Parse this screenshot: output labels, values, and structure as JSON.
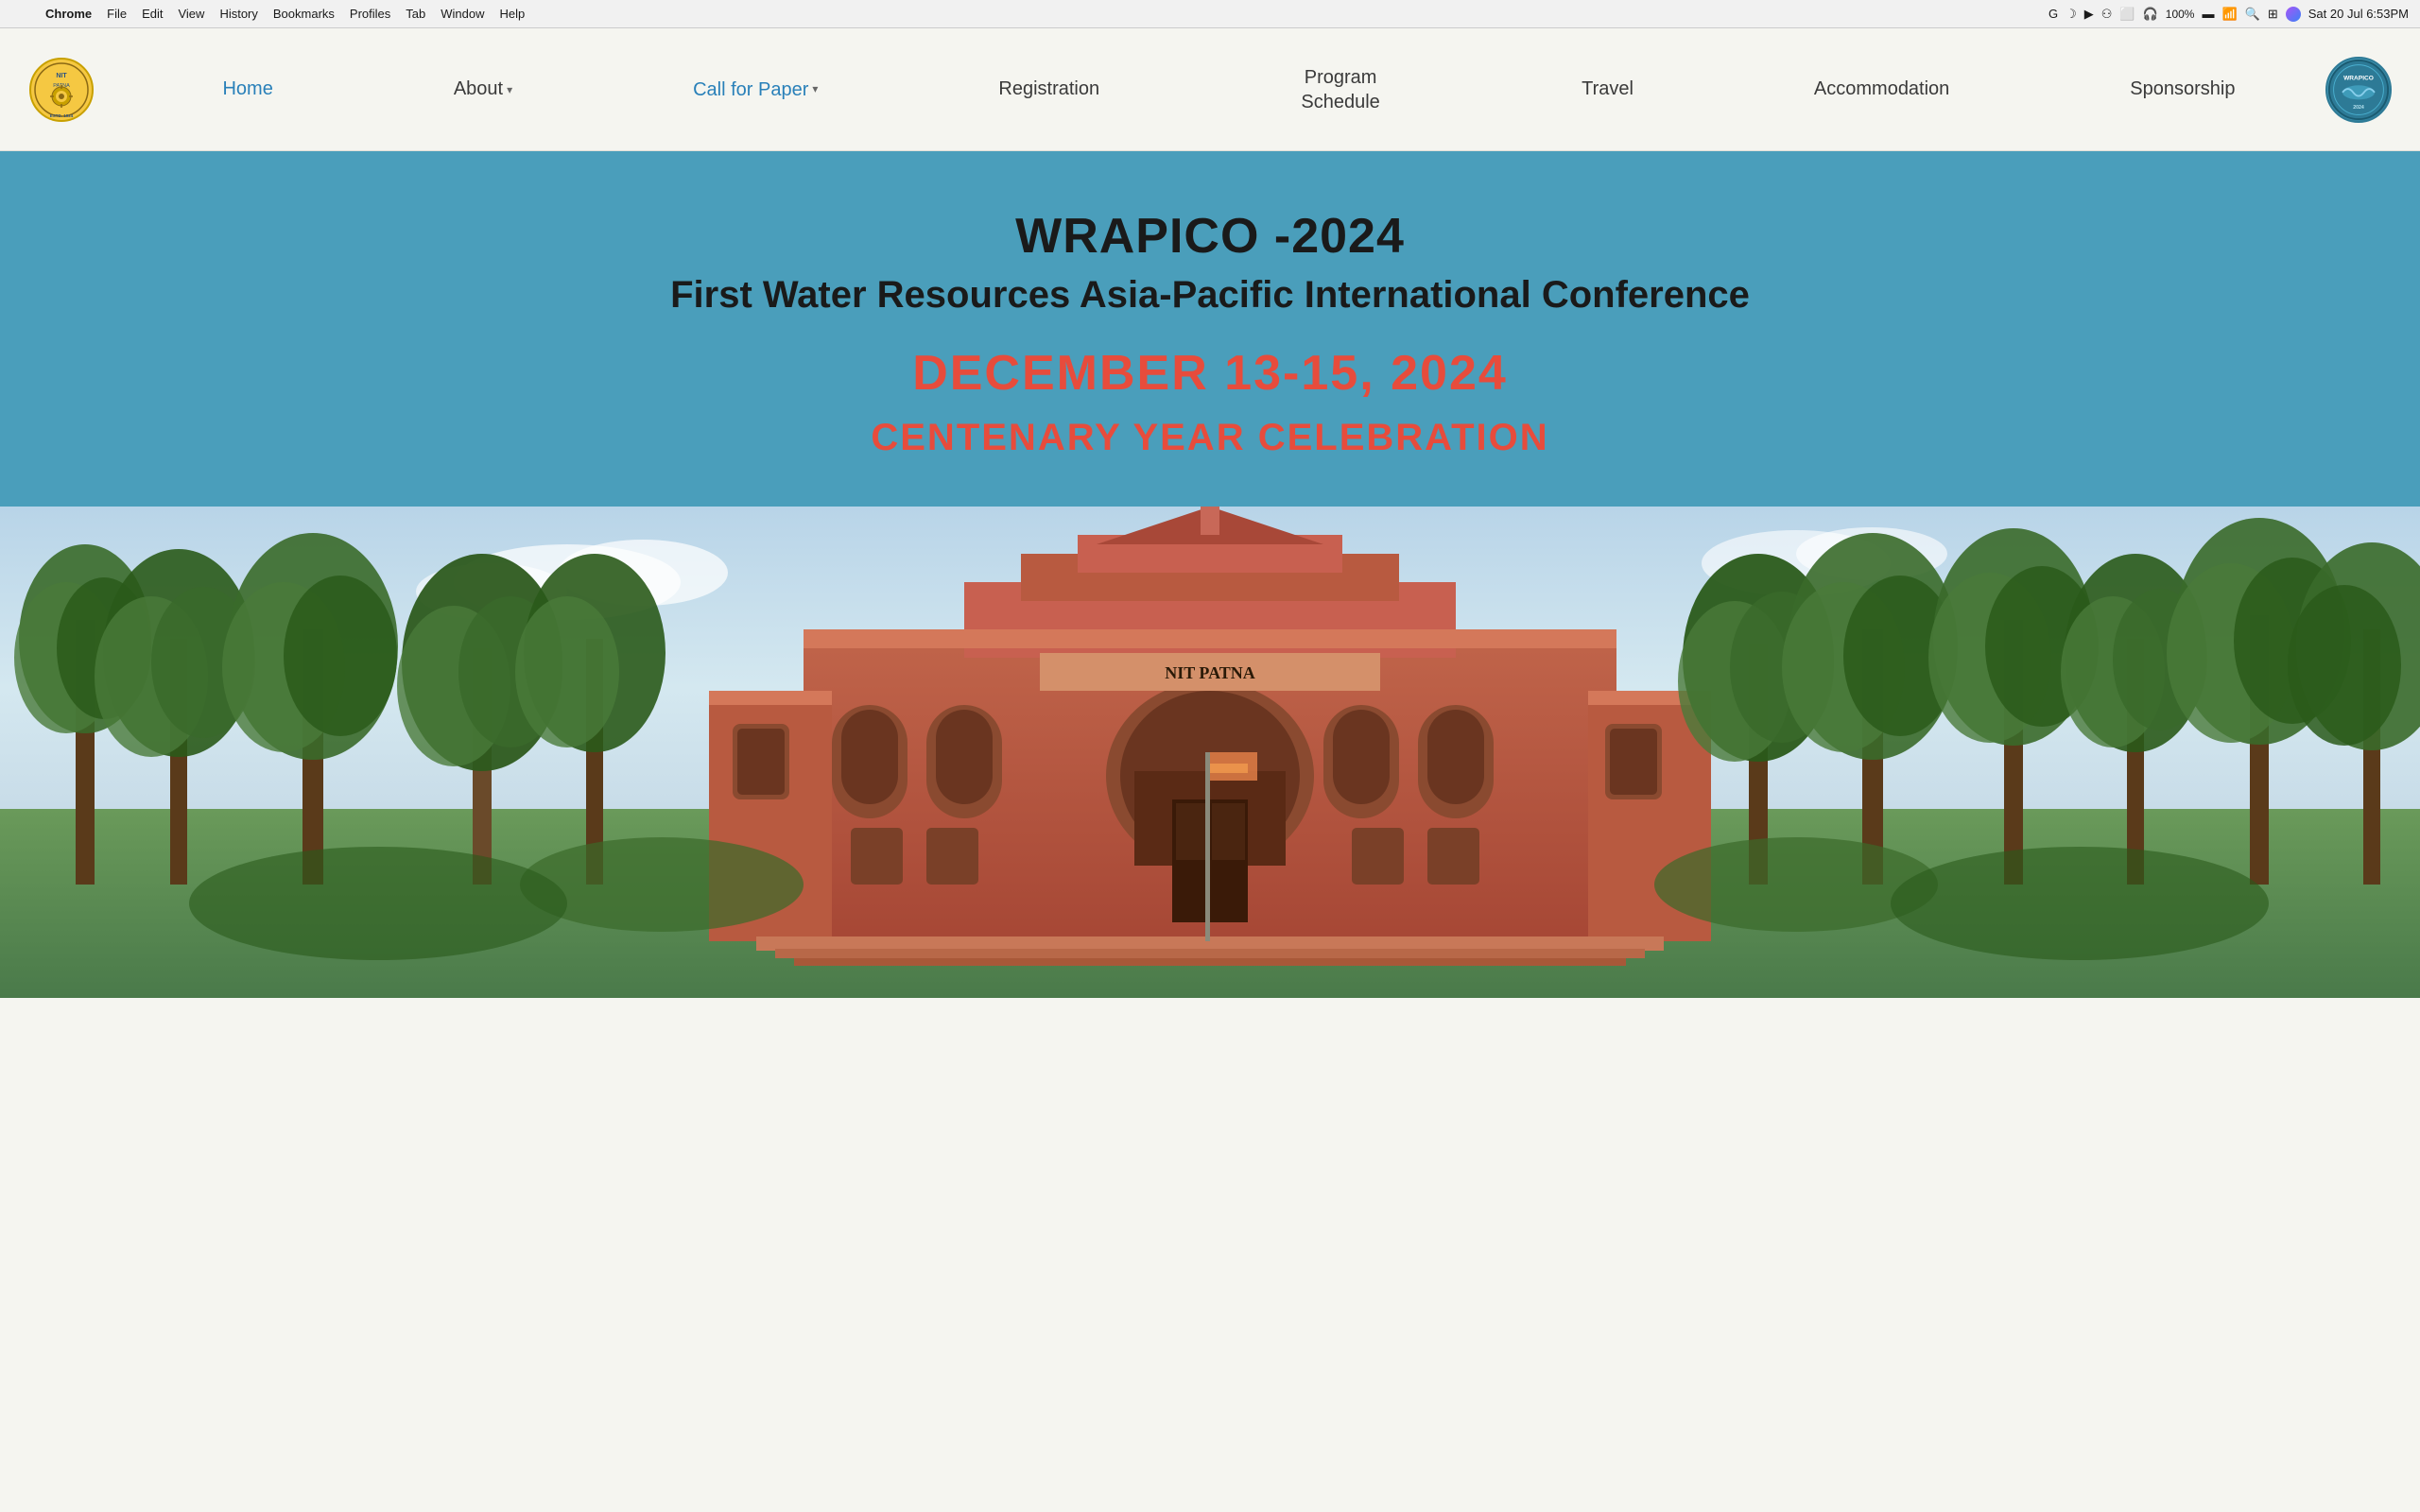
{
  "macbar": {
    "apple": "⌘",
    "menus": [
      "Chrome",
      "File",
      "Edit",
      "View",
      "History",
      "Bookmarks",
      "Profiles",
      "Tab",
      "Window",
      "Help"
    ],
    "time": "Sat 20 Jul  6:53PM",
    "battery_pct": "100%",
    "wifi": "WiFi"
  },
  "nav": {
    "home_label": "Home",
    "about_label": "About",
    "call_for_paper_label": "Call for Paper",
    "registration_label": "Registration",
    "program_schedule_label": "Program Schedule",
    "travel_label": "Travel",
    "accommodation_label": "Accommodation",
    "sponsorship_label": "Sponsorship"
  },
  "hero": {
    "title": "WRAPICO -2024",
    "subtitle": "First Water Resources Asia-Pacific International Conference",
    "date": "DECEMBER 13-15, 2024",
    "celebration": "CENTENARY YEAR CELEBRATION"
  },
  "icons": {
    "chevron_down": "▾",
    "apple_logo": "",
    "search": "🔍",
    "battery": "🔋",
    "wifi": "WiFi",
    "chrome_icon": "⬤"
  }
}
